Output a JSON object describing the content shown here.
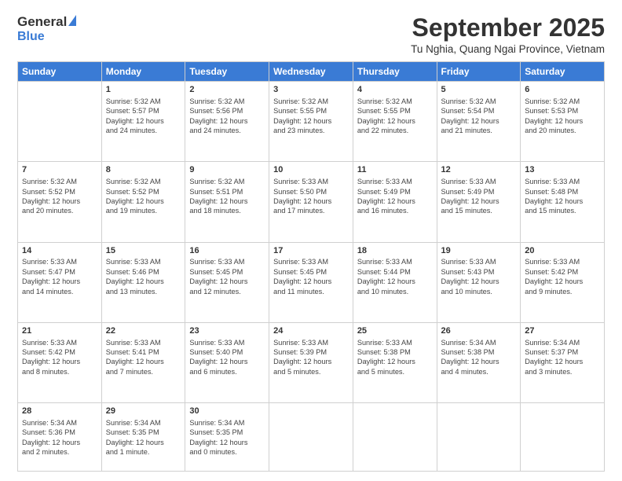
{
  "header": {
    "logo_general": "General",
    "logo_blue": "Blue",
    "month_title": "September 2025",
    "location": "Tu Nghia, Quang Ngai Province, Vietnam"
  },
  "days_of_week": [
    "Sunday",
    "Monday",
    "Tuesday",
    "Wednesday",
    "Thursday",
    "Friday",
    "Saturday"
  ],
  "weeks": [
    [
      {
        "day": "",
        "info": ""
      },
      {
        "day": "1",
        "info": "Sunrise: 5:32 AM\nSunset: 5:57 PM\nDaylight: 12 hours\nand 24 minutes."
      },
      {
        "day": "2",
        "info": "Sunrise: 5:32 AM\nSunset: 5:56 PM\nDaylight: 12 hours\nand 24 minutes."
      },
      {
        "day": "3",
        "info": "Sunrise: 5:32 AM\nSunset: 5:55 PM\nDaylight: 12 hours\nand 23 minutes."
      },
      {
        "day": "4",
        "info": "Sunrise: 5:32 AM\nSunset: 5:55 PM\nDaylight: 12 hours\nand 22 minutes."
      },
      {
        "day": "5",
        "info": "Sunrise: 5:32 AM\nSunset: 5:54 PM\nDaylight: 12 hours\nand 21 minutes."
      },
      {
        "day": "6",
        "info": "Sunrise: 5:32 AM\nSunset: 5:53 PM\nDaylight: 12 hours\nand 20 minutes."
      }
    ],
    [
      {
        "day": "7",
        "info": "Sunrise: 5:32 AM\nSunset: 5:52 PM\nDaylight: 12 hours\nand 20 minutes."
      },
      {
        "day": "8",
        "info": "Sunrise: 5:32 AM\nSunset: 5:52 PM\nDaylight: 12 hours\nand 19 minutes."
      },
      {
        "day": "9",
        "info": "Sunrise: 5:32 AM\nSunset: 5:51 PM\nDaylight: 12 hours\nand 18 minutes."
      },
      {
        "day": "10",
        "info": "Sunrise: 5:33 AM\nSunset: 5:50 PM\nDaylight: 12 hours\nand 17 minutes."
      },
      {
        "day": "11",
        "info": "Sunrise: 5:33 AM\nSunset: 5:49 PM\nDaylight: 12 hours\nand 16 minutes."
      },
      {
        "day": "12",
        "info": "Sunrise: 5:33 AM\nSunset: 5:49 PM\nDaylight: 12 hours\nand 15 minutes."
      },
      {
        "day": "13",
        "info": "Sunrise: 5:33 AM\nSunset: 5:48 PM\nDaylight: 12 hours\nand 15 minutes."
      }
    ],
    [
      {
        "day": "14",
        "info": "Sunrise: 5:33 AM\nSunset: 5:47 PM\nDaylight: 12 hours\nand 14 minutes."
      },
      {
        "day": "15",
        "info": "Sunrise: 5:33 AM\nSunset: 5:46 PM\nDaylight: 12 hours\nand 13 minutes."
      },
      {
        "day": "16",
        "info": "Sunrise: 5:33 AM\nSunset: 5:45 PM\nDaylight: 12 hours\nand 12 minutes."
      },
      {
        "day": "17",
        "info": "Sunrise: 5:33 AM\nSunset: 5:45 PM\nDaylight: 12 hours\nand 11 minutes."
      },
      {
        "day": "18",
        "info": "Sunrise: 5:33 AM\nSunset: 5:44 PM\nDaylight: 12 hours\nand 10 minutes."
      },
      {
        "day": "19",
        "info": "Sunrise: 5:33 AM\nSunset: 5:43 PM\nDaylight: 12 hours\nand 10 minutes."
      },
      {
        "day": "20",
        "info": "Sunrise: 5:33 AM\nSunset: 5:42 PM\nDaylight: 12 hours\nand 9 minutes."
      }
    ],
    [
      {
        "day": "21",
        "info": "Sunrise: 5:33 AM\nSunset: 5:42 PM\nDaylight: 12 hours\nand 8 minutes."
      },
      {
        "day": "22",
        "info": "Sunrise: 5:33 AM\nSunset: 5:41 PM\nDaylight: 12 hours\nand 7 minutes."
      },
      {
        "day": "23",
        "info": "Sunrise: 5:33 AM\nSunset: 5:40 PM\nDaylight: 12 hours\nand 6 minutes."
      },
      {
        "day": "24",
        "info": "Sunrise: 5:33 AM\nSunset: 5:39 PM\nDaylight: 12 hours\nand 5 minutes."
      },
      {
        "day": "25",
        "info": "Sunrise: 5:33 AM\nSunset: 5:38 PM\nDaylight: 12 hours\nand 5 minutes."
      },
      {
        "day": "26",
        "info": "Sunrise: 5:34 AM\nSunset: 5:38 PM\nDaylight: 12 hours\nand 4 minutes."
      },
      {
        "day": "27",
        "info": "Sunrise: 5:34 AM\nSunset: 5:37 PM\nDaylight: 12 hours\nand 3 minutes."
      }
    ],
    [
      {
        "day": "28",
        "info": "Sunrise: 5:34 AM\nSunset: 5:36 PM\nDaylight: 12 hours\nand 2 minutes."
      },
      {
        "day": "29",
        "info": "Sunrise: 5:34 AM\nSunset: 5:35 PM\nDaylight: 12 hours\nand 1 minute."
      },
      {
        "day": "30",
        "info": "Sunrise: 5:34 AM\nSunset: 5:35 PM\nDaylight: 12 hours\nand 0 minutes."
      },
      {
        "day": "",
        "info": ""
      },
      {
        "day": "",
        "info": ""
      },
      {
        "day": "",
        "info": ""
      },
      {
        "day": "",
        "info": ""
      }
    ]
  ]
}
